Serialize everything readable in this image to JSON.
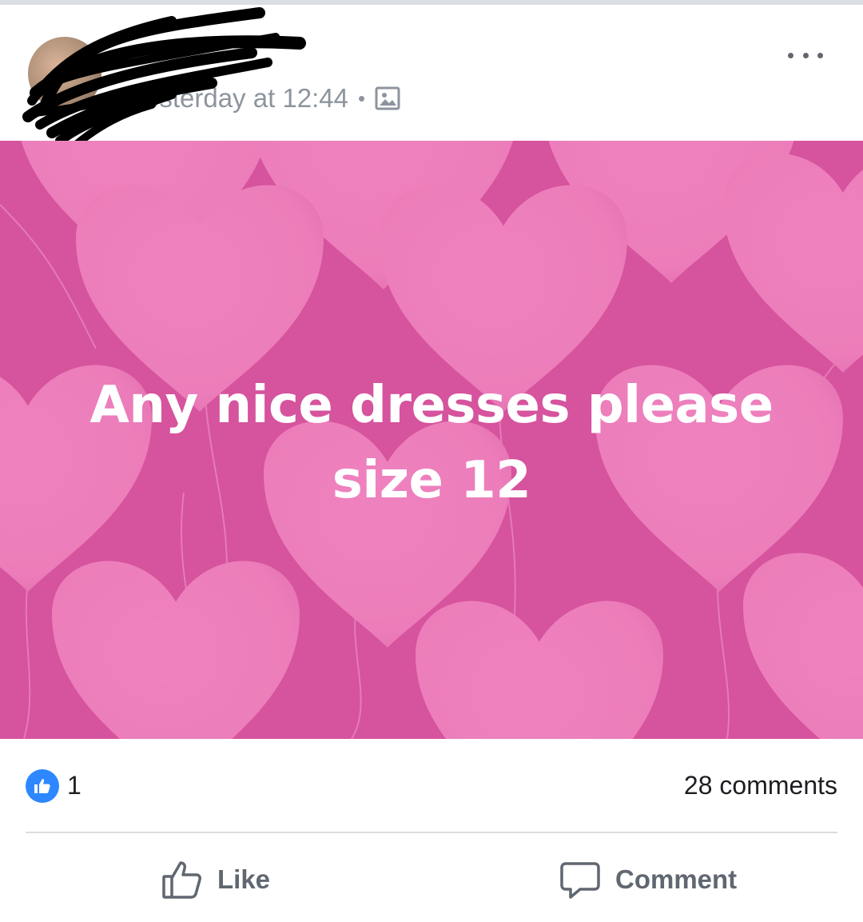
{
  "post": {
    "timestamp": "Yesterday at 12:44",
    "separator": "•",
    "audience_icon": "photo-icon",
    "more_icon": "more-options-icon",
    "image_text_line1": "Any nice dresses please",
    "image_text_line2": "size 12",
    "background_color": "#d6539d",
    "heart_color": "#ec7dba"
  },
  "reactions": {
    "like_count": "1",
    "comments_label": "28 comments"
  },
  "actions": {
    "like_label": "Like",
    "comment_label": "Comment"
  }
}
